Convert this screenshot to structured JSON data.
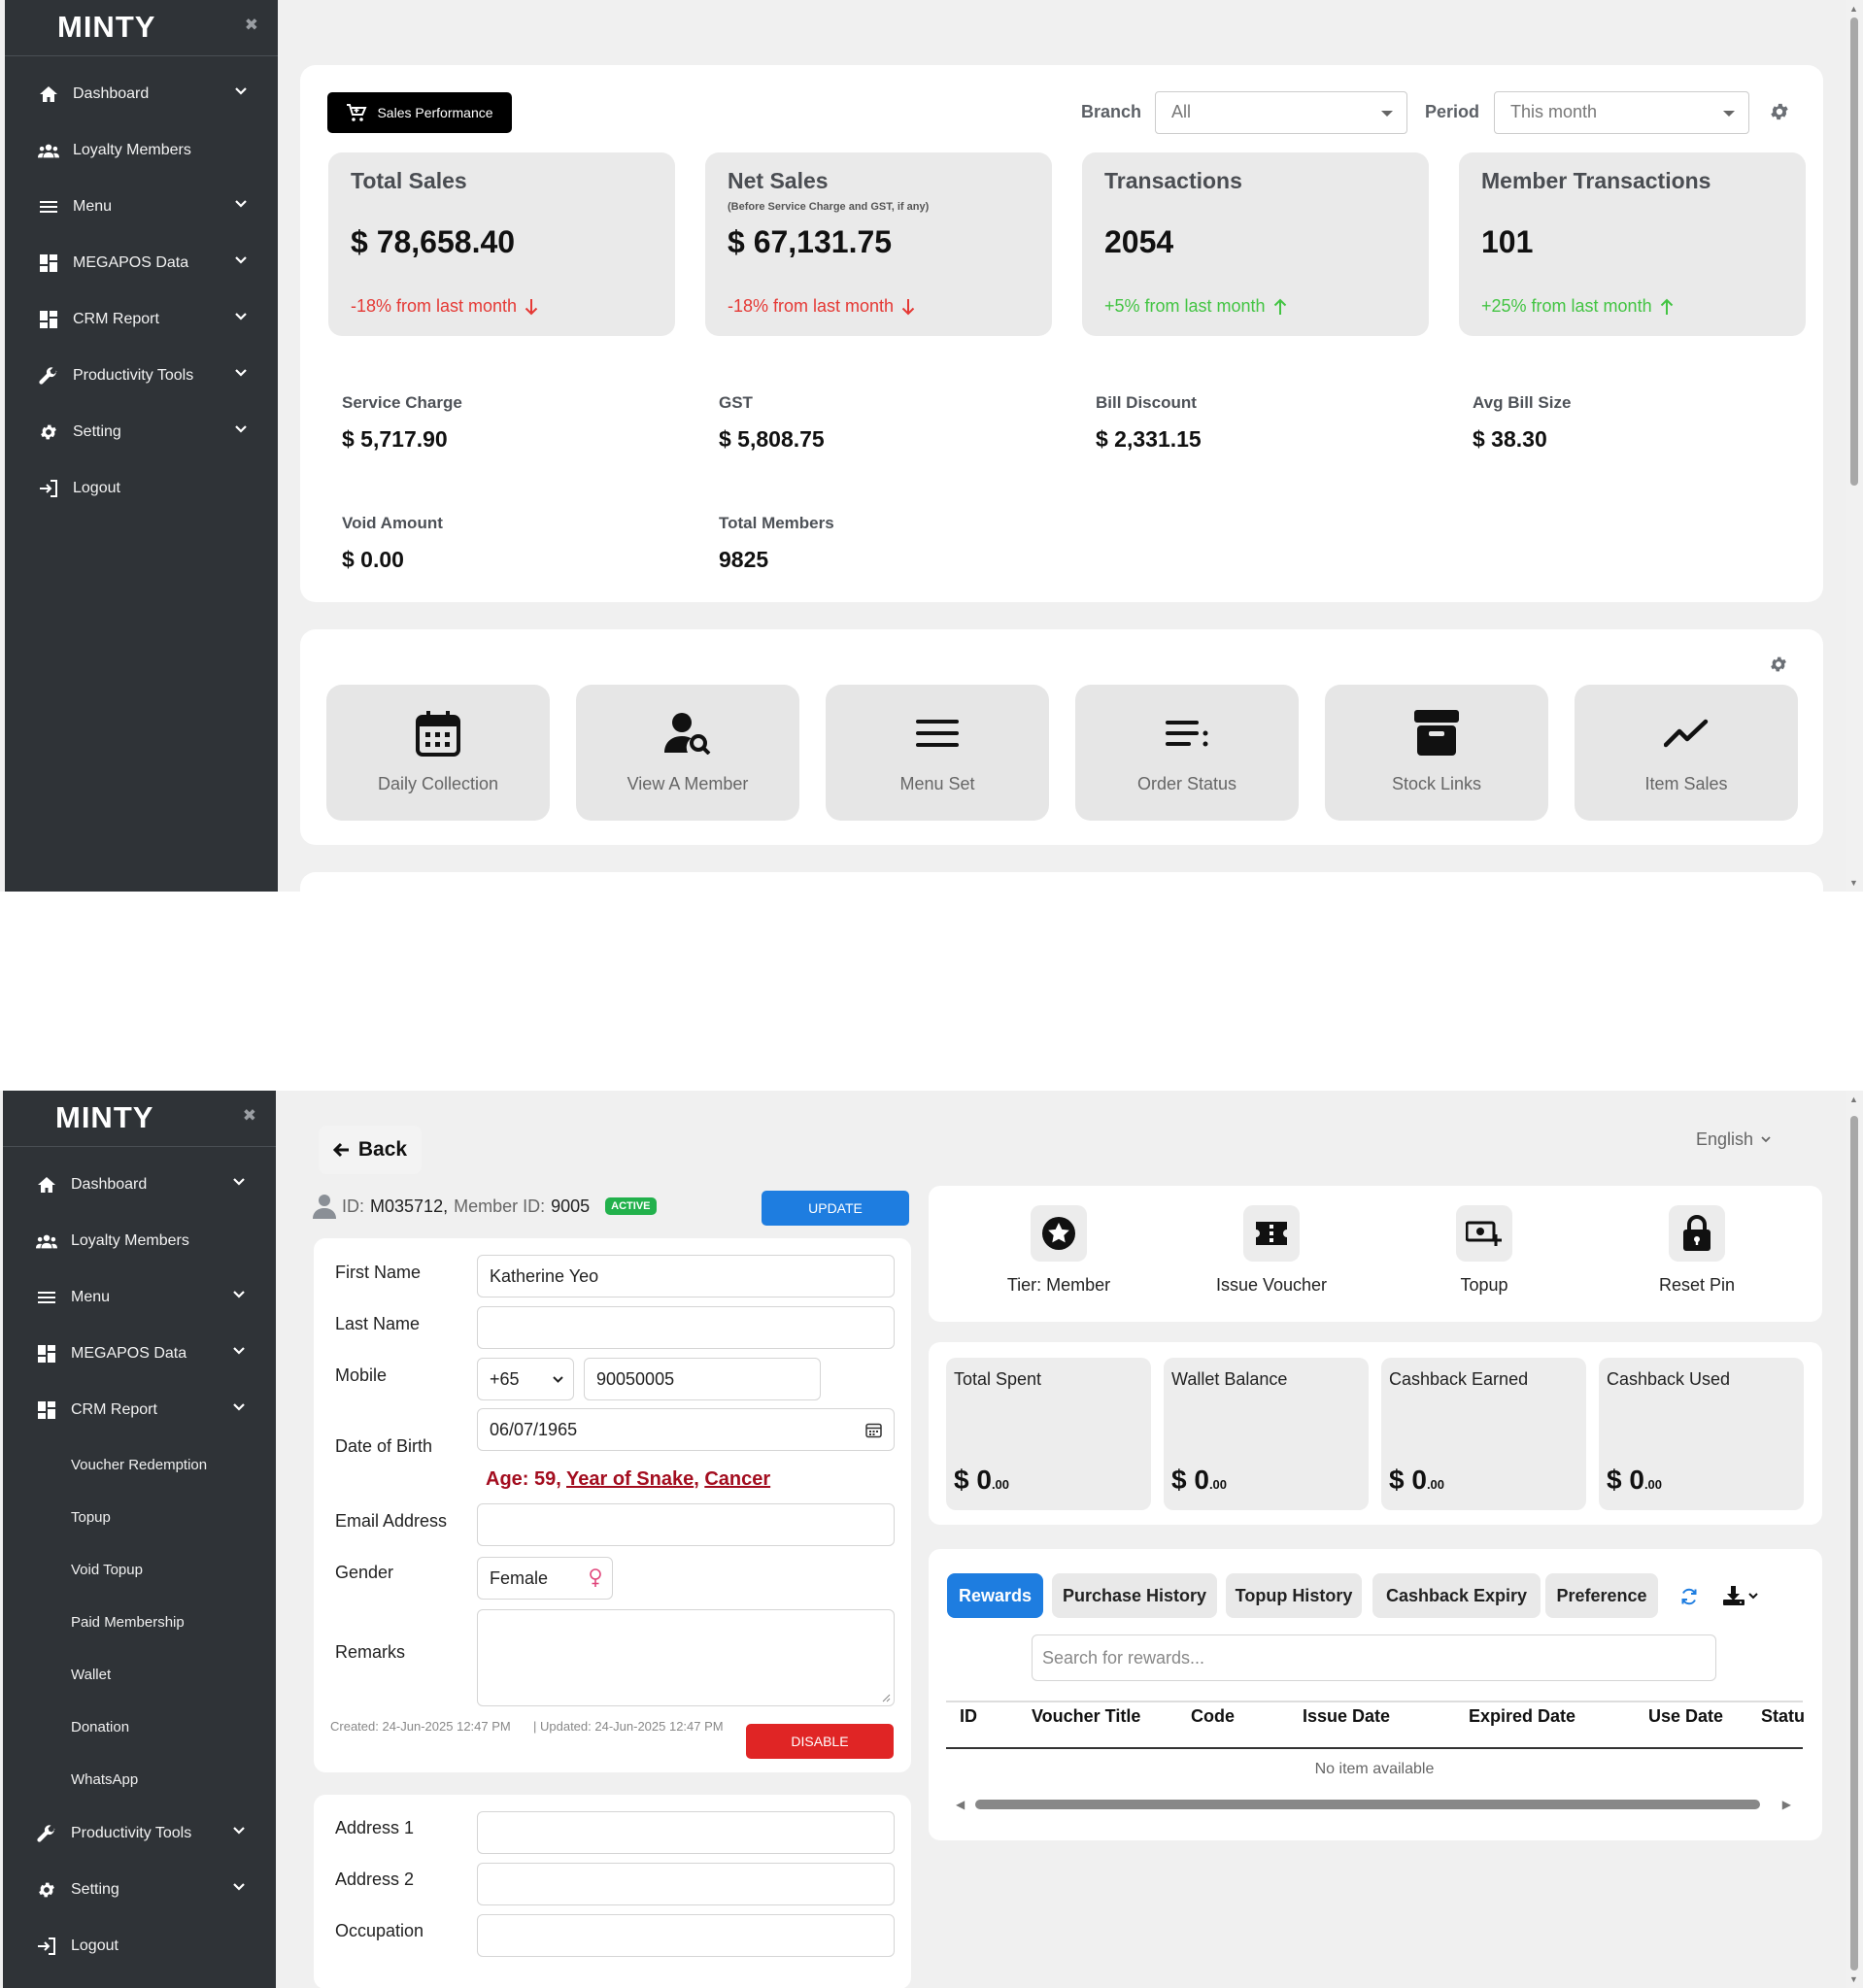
{
  "brand": "MINTY",
  "sidebar1": [
    {
      "label": "Dashboard",
      "chev": true
    },
    {
      "label": "Loyalty Members",
      "chev": false
    },
    {
      "label": "Menu",
      "chev": true
    },
    {
      "label": "MEGAPOS Data",
      "chev": true
    },
    {
      "label": "CRM Report",
      "chev": true
    },
    {
      "label": "Productivity Tools",
      "chev": true
    },
    {
      "label": "Setting",
      "chev": true
    },
    {
      "label": "Logout",
      "chev": false
    }
  ],
  "sidebar2": {
    "items": [
      "Dashboard",
      "Loyalty Members",
      "Menu",
      "MEGAPOS Data",
      "CRM Report"
    ],
    "crm_sub": [
      "Voucher Redemption",
      "Topup",
      "Void Topup",
      "Paid Membership",
      "Wallet",
      "Donation",
      "WhatsApp"
    ],
    "after": [
      "Productivity Tools",
      "Setting",
      "Logout"
    ]
  },
  "dashboard": {
    "sales_btn": "Sales Performance",
    "branch_label": "Branch",
    "branch_value": "All",
    "period_label": "Period",
    "period_value": "This month",
    "kpis": [
      {
        "title": "Total Sales",
        "sub": "",
        "value": "$ 78,658.40",
        "delta": "-18% from last month",
        "dir": "down"
      },
      {
        "title": "Net Sales",
        "sub": "(Before Service Charge and GST, if any)",
        "value": "$ 67,131.75",
        "delta": "-18% from last month",
        "dir": "down"
      },
      {
        "title": "Transactions",
        "sub": "",
        "value": "2054",
        "delta": "+5% from last month",
        "dir": "up"
      },
      {
        "title": "Member Transactions",
        "sub": "",
        "value": "101",
        "delta": "+25% from last month",
        "dir": "up"
      }
    ],
    "stats": [
      {
        "label": "Service Charge",
        "value": "$ 5,717.90"
      },
      {
        "label": "GST",
        "value": "$ 5,808.75"
      },
      {
        "label": "Bill Discount",
        "value": "$ 2,331.15"
      },
      {
        "label": "Avg Bill Size",
        "value": "$ 38.30"
      },
      {
        "label": "Void Amount",
        "value": "$ 0.00"
      },
      {
        "label": "Total Members",
        "value": "9825"
      }
    ],
    "tiles": [
      "Daily Collection",
      "View A Member",
      "Menu Set",
      "Order Status",
      "Stock Links",
      "Item Sales"
    ]
  },
  "member": {
    "back": "Back",
    "language": "English",
    "id_label": "ID:",
    "id": "M035712,",
    "member_id_label": "Member ID:",
    "member_id": "9005",
    "status": "ACTIVE",
    "update": "UPDATE",
    "first_name_label": "First Name",
    "first_name": "Katherine Yeo",
    "last_name_label": "Last Name",
    "last_name": "",
    "mobile_label": "Mobile",
    "country_code": "+65",
    "mobile": "90050005",
    "dob_label": "Date of Birth",
    "dob": "06/07/1965",
    "age_prefix": "Age: 59,",
    "zodiac": "Year of Snake",
    "sign": "Cancer",
    "email_label": "Email Address",
    "email": "",
    "gender_label": "Gender",
    "gender": "Female",
    "remarks_label": "Remarks",
    "created": "Created: 24-Jun-2025 12:47 PM",
    "updated": "| Updated: 24-Jun-2025 12:47 PM",
    "disable": "DISABLE",
    "address1_label": "Address 1",
    "address2_label": "Address 2",
    "occupation_label": "Occupation",
    "actions": [
      "Tier: Member",
      "Issue Voucher",
      "Topup",
      "Reset Pin"
    ],
    "wallet": [
      {
        "label": "Total Spent",
        "value": "0",
        "dec": ".00"
      },
      {
        "label": "Wallet Balance",
        "value": "0",
        "dec": ".00"
      },
      {
        "label": "Cashback Earned",
        "value": "0",
        "dec": ".00"
      },
      {
        "label": "Cashback Used",
        "value": "0",
        "dec": ".00"
      }
    ],
    "currency": "$",
    "tabs": [
      "Rewards",
      "Purchase History",
      "Topup History",
      "Cashback Expiry",
      "Preference"
    ],
    "search_placeholder": "Search for rewards...",
    "columns": [
      "ID",
      "Voucher Title",
      "Code",
      "Issue Date",
      "Expired Date",
      "Use Date",
      "Statu"
    ],
    "empty": "No item available"
  }
}
